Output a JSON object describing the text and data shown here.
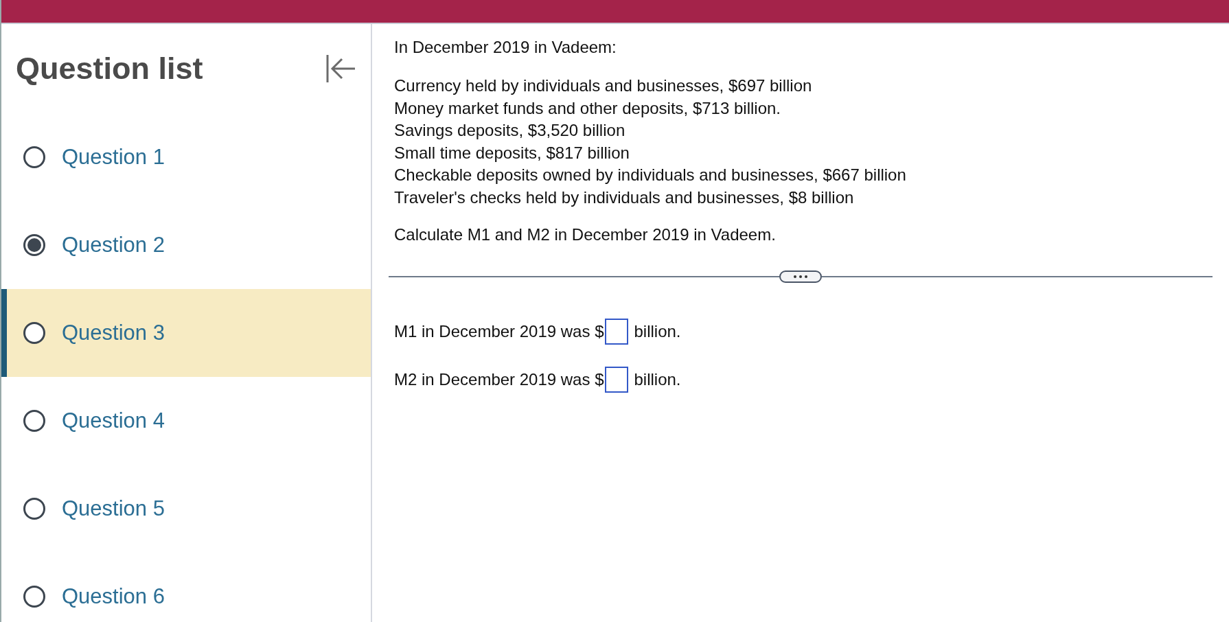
{
  "sidebar": {
    "title": "Question list",
    "questions": [
      {
        "label": "Question 1",
        "answered": false,
        "selected": false
      },
      {
        "label": "Question 2",
        "answered": true,
        "selected": false
      },
      {
        "label": "Question 3",
        "answered": false,
        "selected": true
      },
      {
        "label": "Question 4",
        "answered": false,
        "selected": false
      },
      {
        "label": "Question 5",
        "answered": false,
        "selected": false
      },
      {
        "label": "Question 6",
        "answered": false,
        "selected": false
      }
    ]
  },
  "problem": {
    "intro": "In December 2019 in Vadeem:",
    "facts": [
      "Currency held by individuals and businesses, $697 billion",
      "Money market funds and other deposits, $713 billion.",
      "Savings deposits, $3,520 billion",
      "Small time deposits, $817 billion",
      "Checkable deposits owned by individuals and businesses, $667 billion",
      "Traveler's checks held by individuals and businesses, $8 billion"
    ],
    "task": "Calculate M1 and M2 in December 2019 in Vadeem."
  },
  "answers": [
    {
      "before": "M1 in December 2019 was $",
      "after": "billion."
    },
    {
      "before": "M2 in December 2019 was $",
      "after": "billion."
    }
  ]
}
